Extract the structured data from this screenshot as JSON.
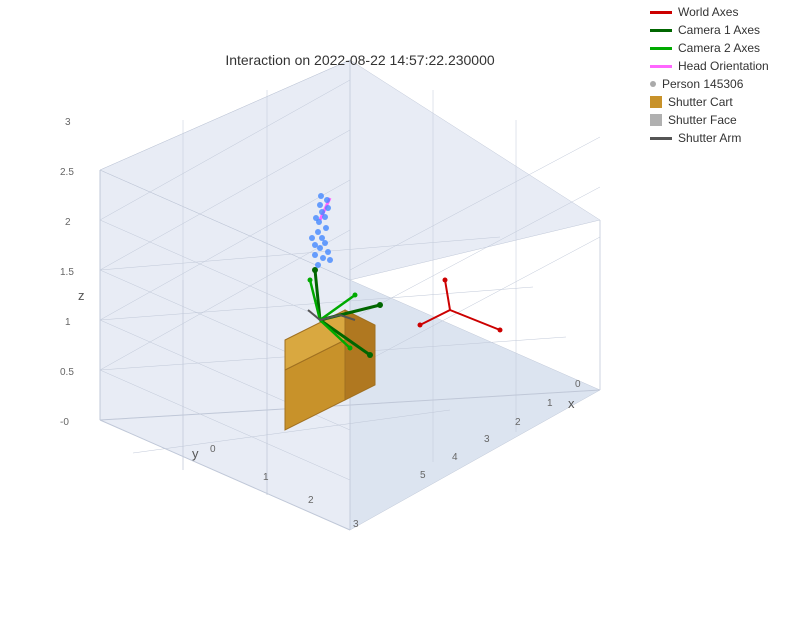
{
  "title": "Interaction on 2022-08-22 14:57:22.230000",
  "legend": {
    "items": [
      {
        "label": "World Axes",
        "type": "line",
        "color": "#cc0000"
      },
      {
        "label": "Camera 1 Axes",
        "type": "line",
        "color": "#006600"
      },
      {
        "label": "Camera 2 Axes",
        "type": "line",
        "color": "#00aa00"
      },
      {
        "label": "Head Orientation",
        "type": "line",
        "color": "#ff66ff"
      },
      {
        "label": "Person 145306",
        "type": "dot",
        "color": "#aaaaaa"
      },
      {
        "label": "Shutter Cart",
        "type": "square",
        "color": "#c8922a"
      },
      {
        "label": "Shutter Face",
        "type": "square",
        "color": "#b0b0b0"
      },
      {
        "label": "Shutter Arm",
        "type": "line",
        "color": "#555555"
      }
    ]
  },
  "axes": {
    "x_label": "x",
    "y_label": "y",
    "z_label": "z",
    "x_ticks": [
      "0",
      "1",
      "2",
      "3",
      "4",
      "5"
    ],
    "y_ticks": [
      "0",
      "1",
      "2",
      "3"
    ],
    "z_ticks": [
      "-0",
      "0.5",
      "1",
      "1.5",
      "2",
      "2.5",
      "3"
    ]
  }
}
